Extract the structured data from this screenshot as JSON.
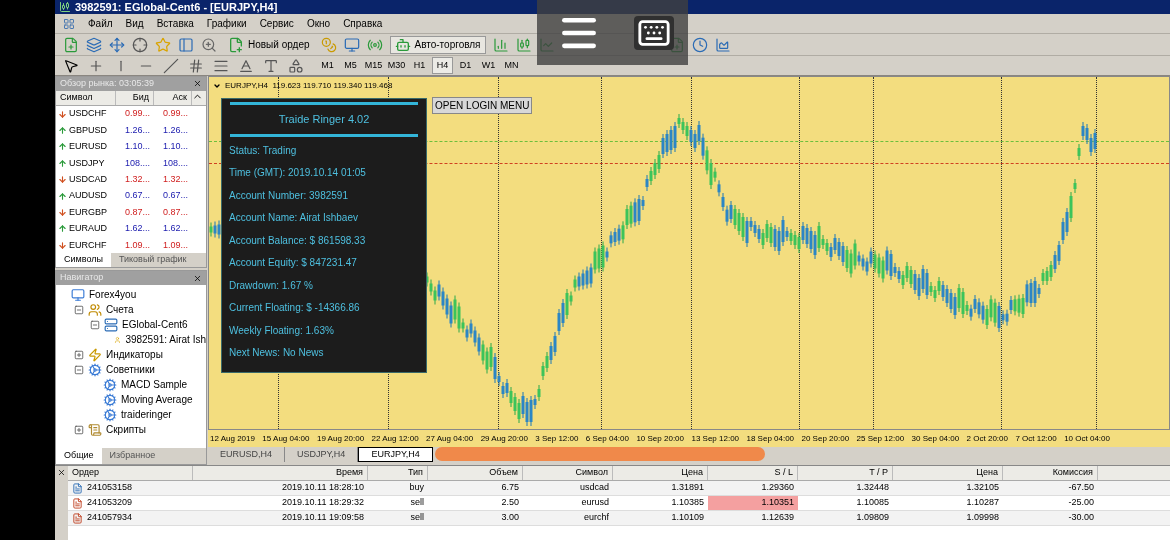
{
  "window": {
    "title": "3982591: EGlobal-Cent6 - [EURJPY,H4]"
  },
  "menu": [
    "Файл",
    "Вид",
    "Вставка",
    "Графики",
    "Сервис",
    "Окно",
    "Справка"
  ],
  "toolbar": {
    "new_order": "Новый ордер",
    "auto_trading": "Авто-торговля"
  },
  "timeframes": [
    {
      "label": "M1",
      "selected": false
    },
    {
      "label": "M5",
      "selected": false
    },
    {
      "label": "M15",
      "selected": false
    },
    {
      "label": "M30",
      "selected": false
    },
    {
      "label": "H1",
      "selected": false
    },
    {
      "label": "H4",
      "selected": true
    },
    {
      "label": "D1",
      "selected": false
    },
    {
      "label": "W1",
      "selected": false
    },
    {
      "label": "MN",
      "selected": false
    }
  ],
  "market_watch": {
    "title": "Обзор рынка: 03:05:39",
    "columns": [
      "Символ",
      "Бид",
      "Аск"
    ],
    "rows": [
      {
        "symbol": "USDCHF",
        "bid": "0.99...",
        "ask": "0.99...",
        "rising": false
      },
      {
        "symbol": "GBPUSD",
        "bid": "1.26...",
        "ask": "1.26...",
        "rising": true
      },
      {
        "symbol": "EURUSD",
        "bid": "1.10...",
        "ask": "1.10...",
        "rising": true
      },
      {
        "symbol": "USDJPY",
        "bid": "108....",
        "ask": "108....",
        "rising": true
      },
      {
        "symbol": "USDCAD",
        "bid": "1.32...",
        "ask": "1.32...",
        "rising": false
      },
      {
        "symbol": "AUDUSD",
        "bid": "0.67...",
        "ask": "0.67...",
        "rising": true
      },
      {
        "symbol": "EURGBP",
        "bid": "0.87...",
        "ask": "0.87...",
        "rising": false
      },
      {
        "symbol": "EURAUD",
        "bid": "1.62...",
        "ask": "1.62...",
        "rising": true
      },
      {
        "symbol": "EURCHF",
        "bid": "1.09...",
        "ask": "1.09...",
        "rising": false
      }
    ],
    "tabs": [
      {
        "label": "Символы",
        "selected": true
      },
      {
        "label": "Тиковый график",
        "selected": false
      }
    ]
  },
  "navigator": {
    "title": "Навигатор",
    "tree": [
      {
        "label": "Forex4you",
        "kind": "broker",
        "children": [
          {
            "label": "Счета",
            "kind": "accounts",
            "expanded": true,
            "children": [
              {
                "label": "EGlobal-Cent6",
                "kind": "server",
                "expanded": true,
                "children": [
                  {
                    "label": "3982591: Airat Ish",
                    "kind": "account"
                  }
                ]
              }
            ]
          },
          {
            "label": "Индикаторы",
            "kind": "indicators",
            "expanded": false
          },
          {
            "label": "Советники",
            "kind": "experts",
            "expanded": true,
            "children": [
              {
                "label": "MACD Sample",
                "kind": "expert"
              },
              {
                "label": "Moving Average",
                "kind": "expert"
              },
              {
                "label": "traideringer",
                "kind": "expert"
              }
            ]
          },
          {
            "label": "Скрипты",
            "kind": "scripts",
            "expanded": false
          }
        ]
      }
    ],
    "tabs": [
      {
        "label": "Общие",
        "selected": true
      },
      {
        "label": "Избранное",
        "selected": false
      }
    ]
  },
  "chart": {
    "header": "EURJPY,H4  119.623 119.710 119.340 119.468",
    "login_button": "OPEN LOGIN MENU",
    "info_panel": {
      "title": "Traide Ringer 4.02",
      "lines": [
        "Status: Trading",
        "Time (GMT): 2019.10.14 01:05",
        "Account Number: 3982591",
        "Account Name: Airat Ishbaev",
        "Account Balance: $ 861598.33",
        "Account Equity: $ 847231.47",
        "Drawdown: 1.67 %",
        "Current Floating: $ -14366.86",
        "Weekly Floating: 1.63%",
        "Next News: No News"
      ]
    },
    "x_labels": [
      "12 Aug 2019",
      "15 Aug 04:00",
      "19 Aug 20:00",
      "22 Aug 12:00",
      "27 Aug 04:00",
      "29 Aug 20:00",
      "3 Sep 12:00",
      "6 Sep 04:00",
      "10 Sep 20:00",
      "13 Sep 12:00",
      "18 Sep 04:00",
      "20 Sep 20:00",
      "25 Sep 12:00",
      "30 Sep 04:00",
      "2 Oct 20:00",
      "7 Oct 12:00",
      "10 Oct 04:00"
    ],
    "tabs": [
      {
        "label": "EURUSD,H4",
        "selected": false
      },
      {
        "label": "USDJPY,H4",
        "selected": false
      },
      {
        "label": "EURJPY,H4",
        "selected": true
      }
    ]
  },
  "terminal": {
    "columns": [
      "Ордер",
      "Время",
      "Тип",
      "Объем",
      "Символ",
      "Цена",
      "S / L",
      "T / P",
      "Цена",
      "Комиссия"
    ],
    "rows": [
      {
        "cells": [
          "241053158",
          "2019.10.11 18:28:10",
          "buy",
          "6.75",
          "usdcad",
          "1.31891",
          "1.29360",
          "1.32448",
          "1.32105",
          "-67.50"
        ],
        "sl_highlight": false
      },
      {
        "cells": [
          "241053209",
          "2019.10.11 18:29:32",
          "sell",
          "2.50",
          "eurusd",
          "1.10385",
          "1.10351",
          "1.10085",
          "1.10287",
          "-25.00"
        ],
        "sl_highlight": true
      },
      {
        "cells": [
          "241057934",
          "2019.10.11 19:09:58",
          "sell",
          "3.00",
          "eurchf",
          "1.10109",
          "1.12639",
          "1.09809",
          "1.09998",
          "-30.00"
        ],
        "sl_highlight": false
      }
    ]
  }
}
